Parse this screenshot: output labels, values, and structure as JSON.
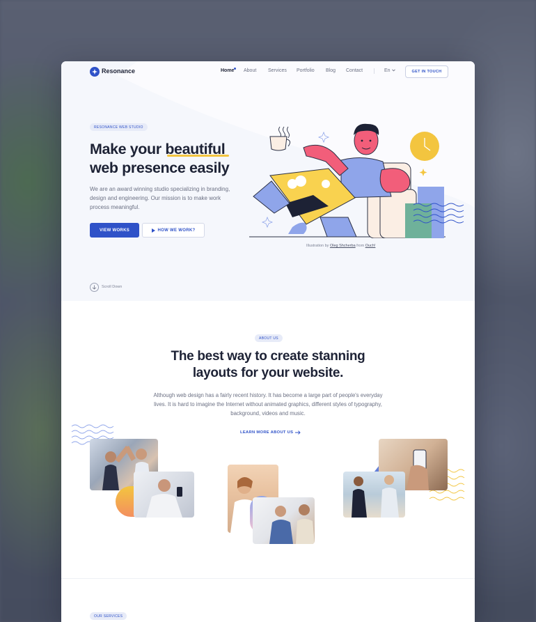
{
  "brand": {
    "name": "Resonance",
    "accent": "#2f52c8",
    "highlight": "#f3c53f"
  },
  "nav": {
    "links": [
      "Home",
      "About",
      "Services",
      "Portfolio",
      "Blog",
      "Contact"
    ],
    "active": "Home",
    "language": "En",
    "cta": "GET IN TOUCH"
  },
  "hero": {
    "eyebrow": "RESONANCE WEB STUDIO",
    "title_line1_a": "Make your ",
    "title_line1_b": "beautiful",
    "title_line2": "web presence easily",
    "description": "We are an award winning studio specializing in branding, design and engineering. Our mission is to make work process meaningful.",
    "primary_button": "VIEW WORKS",
    "secondary_button": "HOW WE WORK?",
    "credit_prefix": "Illustration by ",
    "credit_author": "Oleg Shcherba",
    "credit_mid": " from ",
    "credit_source": "Ouch!",
    "scroll_label": "Scroll Down"
  },
  "about": {
    "eyebrow": "ABOUT US",
    "title_line1": "The best way to create stanning",
    "title_line2": "layouts for your website.",
    "description": "Although web design has a fairly recent history. It has become a large part of people's everyday lives. It is hard to imagine the Internet without animated graphics, different styles of typography, background, videos and music.",
    "link": "LEARN MORE ABOUT US"
  },
  "services": {
    "eyebrow": "OUR SERVICES"
  },
  "icons": [
    "logo-star-icon",
    "chevron-down-icon",
    "play-icon",
    "arrow-right-icon",
    "arrow-down-icon"
  ]
}
